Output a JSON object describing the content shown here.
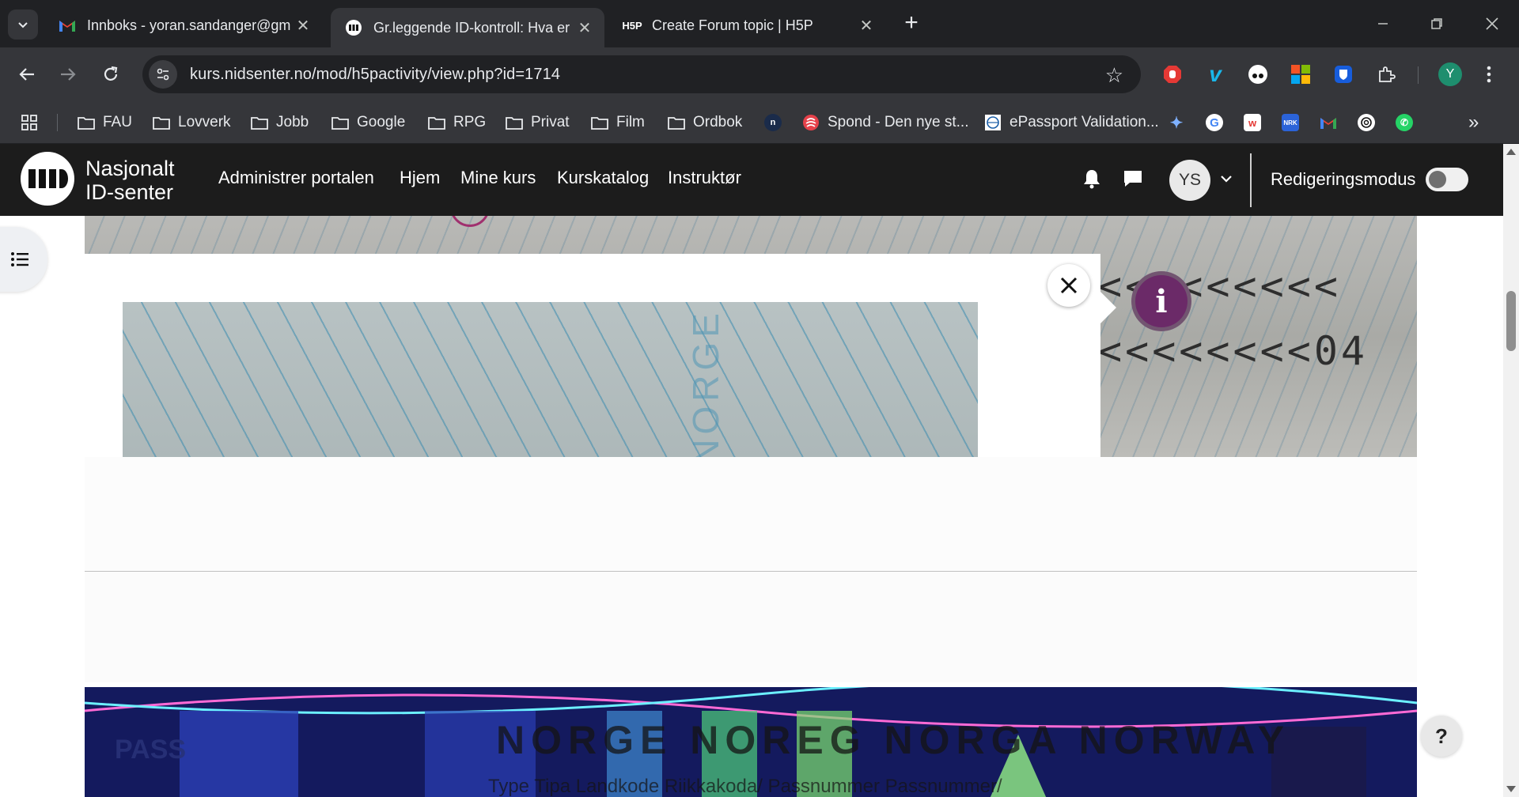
{
  "tabs": [
    {
      "title": "Innboks - yoran.sandanger@gm",
      "icon": "gmail-icon",
      "active": false
    },
    {
      "title": "Gr.leggende ID-kontroll: Hva er",
      "icon": "nidsenter-icon",
      "active": true
    },
    {
      "title": "Create Forum topic | H5P",
      "icon": "h5p-icon",
      "active": false
    }
  ],
  "toolbar": {
    "url": "kurs.nidsenter.no/mod/h5pactivity/view.php?id=1714",
    "profile_initial": "Y"
  },
  "bookmarks": [
    {
      "label": "FAU",
      "icon": "folder-icon"
    },
    {
      "label": "Lovverk",
      "icon": "folder-icon"
    },
    {
      "label": "Jobb",
      "icon": "folder-icon"
    },
    {
      "label": "Google",
      "icon": "folder-icon"
    },
    {
      "label": "RPG",
      "icon": "folder-icon"
    },
    {
      "label": "Privat",
      "icon": "folder-icon"
    },
    {
      "label": "Film",
      "icon": "folder-icon"
    },
    {
      "label": "Ordbok",
      "icon": "folder-icon"
    },
    {
      "label": "Spond - Den nye st...",
      "icon": "spond-icon"
    },
    {
      "label": "ePassport Validation...",
      "icon": "icao-icon"
    }
  ],
  "site": {
    "logo_line1": "Nasjonalt",
    "logo_line2": "ID-senter",
    "nav": [
      "Administrer portalen",
      "Hjem",
      "Mine kurs",
      "Kurskatalog",
      "Instruktør"
    ],
    "avatar_initials": "YS",
    "edit_mode_label": "Redigeringsmodus"
  },
  "content": {
    "mrz_line1": "<<<<<<<<<",
    "mrz_line2": "<<<<<<<<04",
    "info_glyph": "i",
    "popup_watermark": "NORGE",
    "uv_title": "NORGE NOREG NORGA NORWAY",
    "uv_pass": "PASS",
    "uv_sub": "Type Tipa   Landkode Riikkakoda/   Passnummer Passnummer/",
    "help_glyph": "?"
  },
  "colors": {
    "header_bg": "#1c1c1c",
    "hotspot": "#6b2a68",
    "chrome_dark": "#202124",
    "chrome_mid": "#35363a"
  }
}
